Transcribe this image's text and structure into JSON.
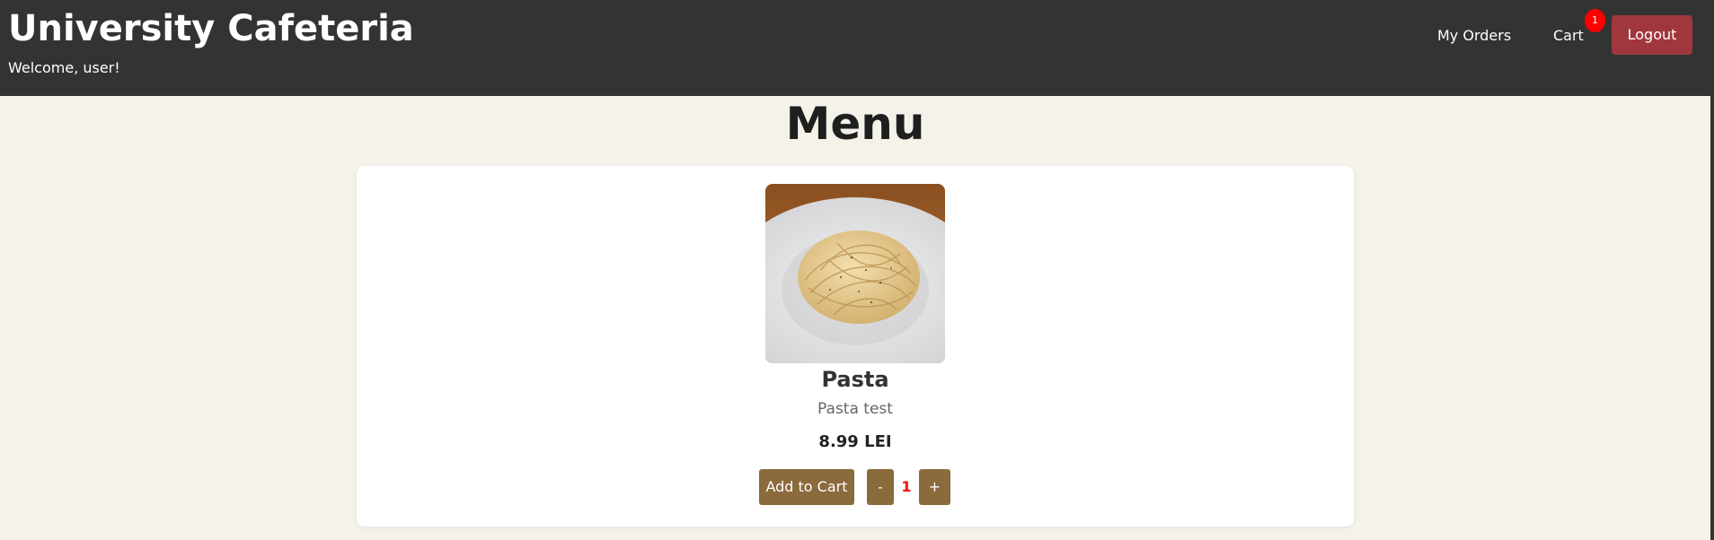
{
  "header": {
    "brand": "University Cafeteria",
    "welcome": "Welcome, user!",
    "nav": {
      "orders_label": "My Orders",
      "cart_label": "Cart",
      "cart_count": "1",
      "logout_label": "Logout"
    }
  },
  "page": {
    "title": "Menu"
  },
  "menu_items": [
    {
      "name": "Pasta",
      "description": "Pasta test",
      "price": "8.99 LEI",
      "image_icon": "pasta-image",
      "add_label": "Add to Cart",
      "decrement_label": "-",
      "quantity": "1",
      "increment_label": "+"
    }
  ],
  "colors": {
    "header_bg": "#333333",
    "page_bg": "#f5f2ea",
    "accent_button": "#8b6a3c",
    "logout_button": "#a0373d",
    "badge": "#ff0000",
    "quantity_text": "#ff0000"
  }
}
